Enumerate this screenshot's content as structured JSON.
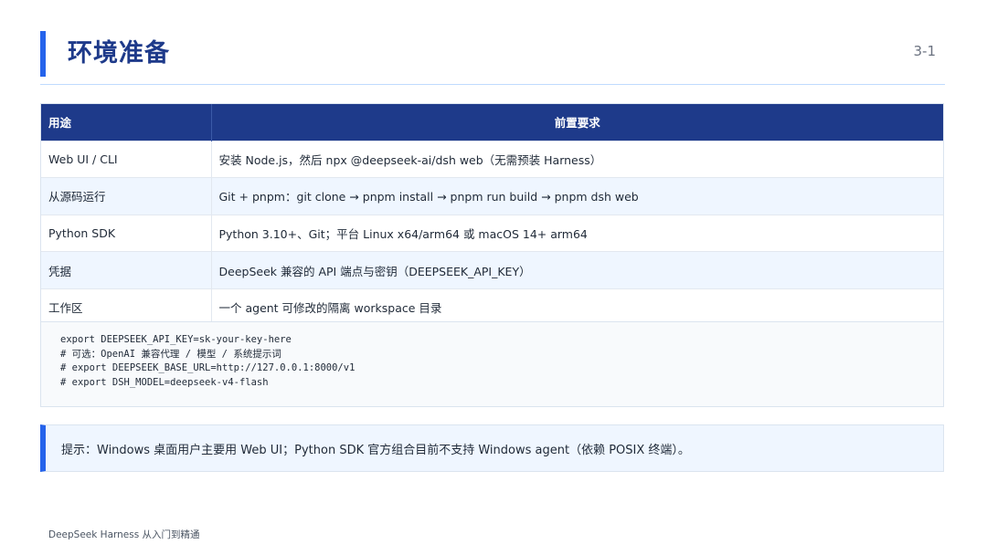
{
  "header": {
    "title": "环境准备",
    "page_number": "3-1"
  },
  "table": {
    "columns": [
      "用途",
      "前置要求"
    ],
    "rows": [
      {
        "use": "Web UI / CLI",
        "requirement": "安装 Node.js，然后 npx @deepseek-ai/dsh web（无需预装 Harness）"
      },
      {
        "use": "从源码运行",
        "requirement": "Git + pnpm：git clone → pnpm install → pnpm run build → pnpm dsh web"
      },
      {
        "use": "Python SDK",
        "requirement": "Python 3.10+、Git；平台 Linux x64/arm64 或 macOS 14+ arm64"
      },
      {
        "use": "凭据",
        "requirement": "DeepSeek 兼容的 API 端点与密钥（DEEPSEEK_API_KEY）"
      },
      {
        "use": "工作区",
        "requirement": "一个 agent 可修改的隔离 workspace 目录"
      }
    ]
  },
  "code": {
    "lines": [
      "export DEEPSEEK_API_KEY=sk-your-key-here",
      "# 可选：OpenAI 兼容代理 / 模型 / 系统提示词",
      "# export DEEPSEEK_BASE_URL=http://127.0.0.1:8000/v1",
      "# export DSH_MODEL=deepseek-v4-flash"
    ]
  },
  "tip": {
    "text": "提示：Windows 桌面用户主要用 Web UI；Python SDK 官方组合目前不支持 Windows agent（依赖 POSIX 终端）。"
  },
  "footer": {
    "text": "DeepSeek Harness 从入门到精通"
  },
  "colors": {
    "accent": "#2563eb",
    "header_bg": "#1e3a8a",
    "alt_row_bg": "#eff6ff"
  }
}
